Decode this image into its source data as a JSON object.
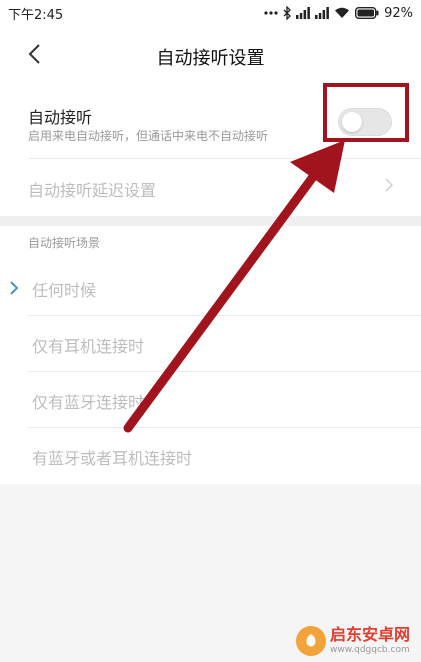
{
  "status_bar": {
    "time": "下午2:45",
    "battery_percent": "92%",
    "icons": [
      "dots-icon",
      "bluetooth-icon",
      "signal-icon",
      "signal-icon",
      "wifi-icon",
      "battery-icon"
    ]
  },
  "header": {
    "title": "自动接听设置",
    "back_icon": "chevron-left-icon"
  },
  "auto_answer": {
    "title": "自动接听",
    "subtitle": "启用来电自动接听，但通话中来电不自动接听",
    "enabled": false
  },
  "delay_setting": {
    "label": "自动接听延迟设置"
  },
  "scenarios": {
    "header": "自动接听场景",
    "items": [
      {
        "label": "任何时候",
        "selected": true
      },
      {
        "label": "仅有耳机连接时",
        "selected": false
      },
      {
        "label": "仅有蓝牙连接时",
        "selected": false
      },
      {
        "label": "有蓝牙或者耳机连接时",
        "selected": false
      }
    ]
  },
  "annotation": {
    "color": "#a1141d"
  },
  "watermark": {
    "name": "启东安卓网",
    "url": "www.qdgqcb.com"
  },
  "colors": {
    "accent_check": "#2b8fd6",
    "disabled_text": "#bdbdbd",
    "subtitle_text": "#9a9a9a"
  }
}
